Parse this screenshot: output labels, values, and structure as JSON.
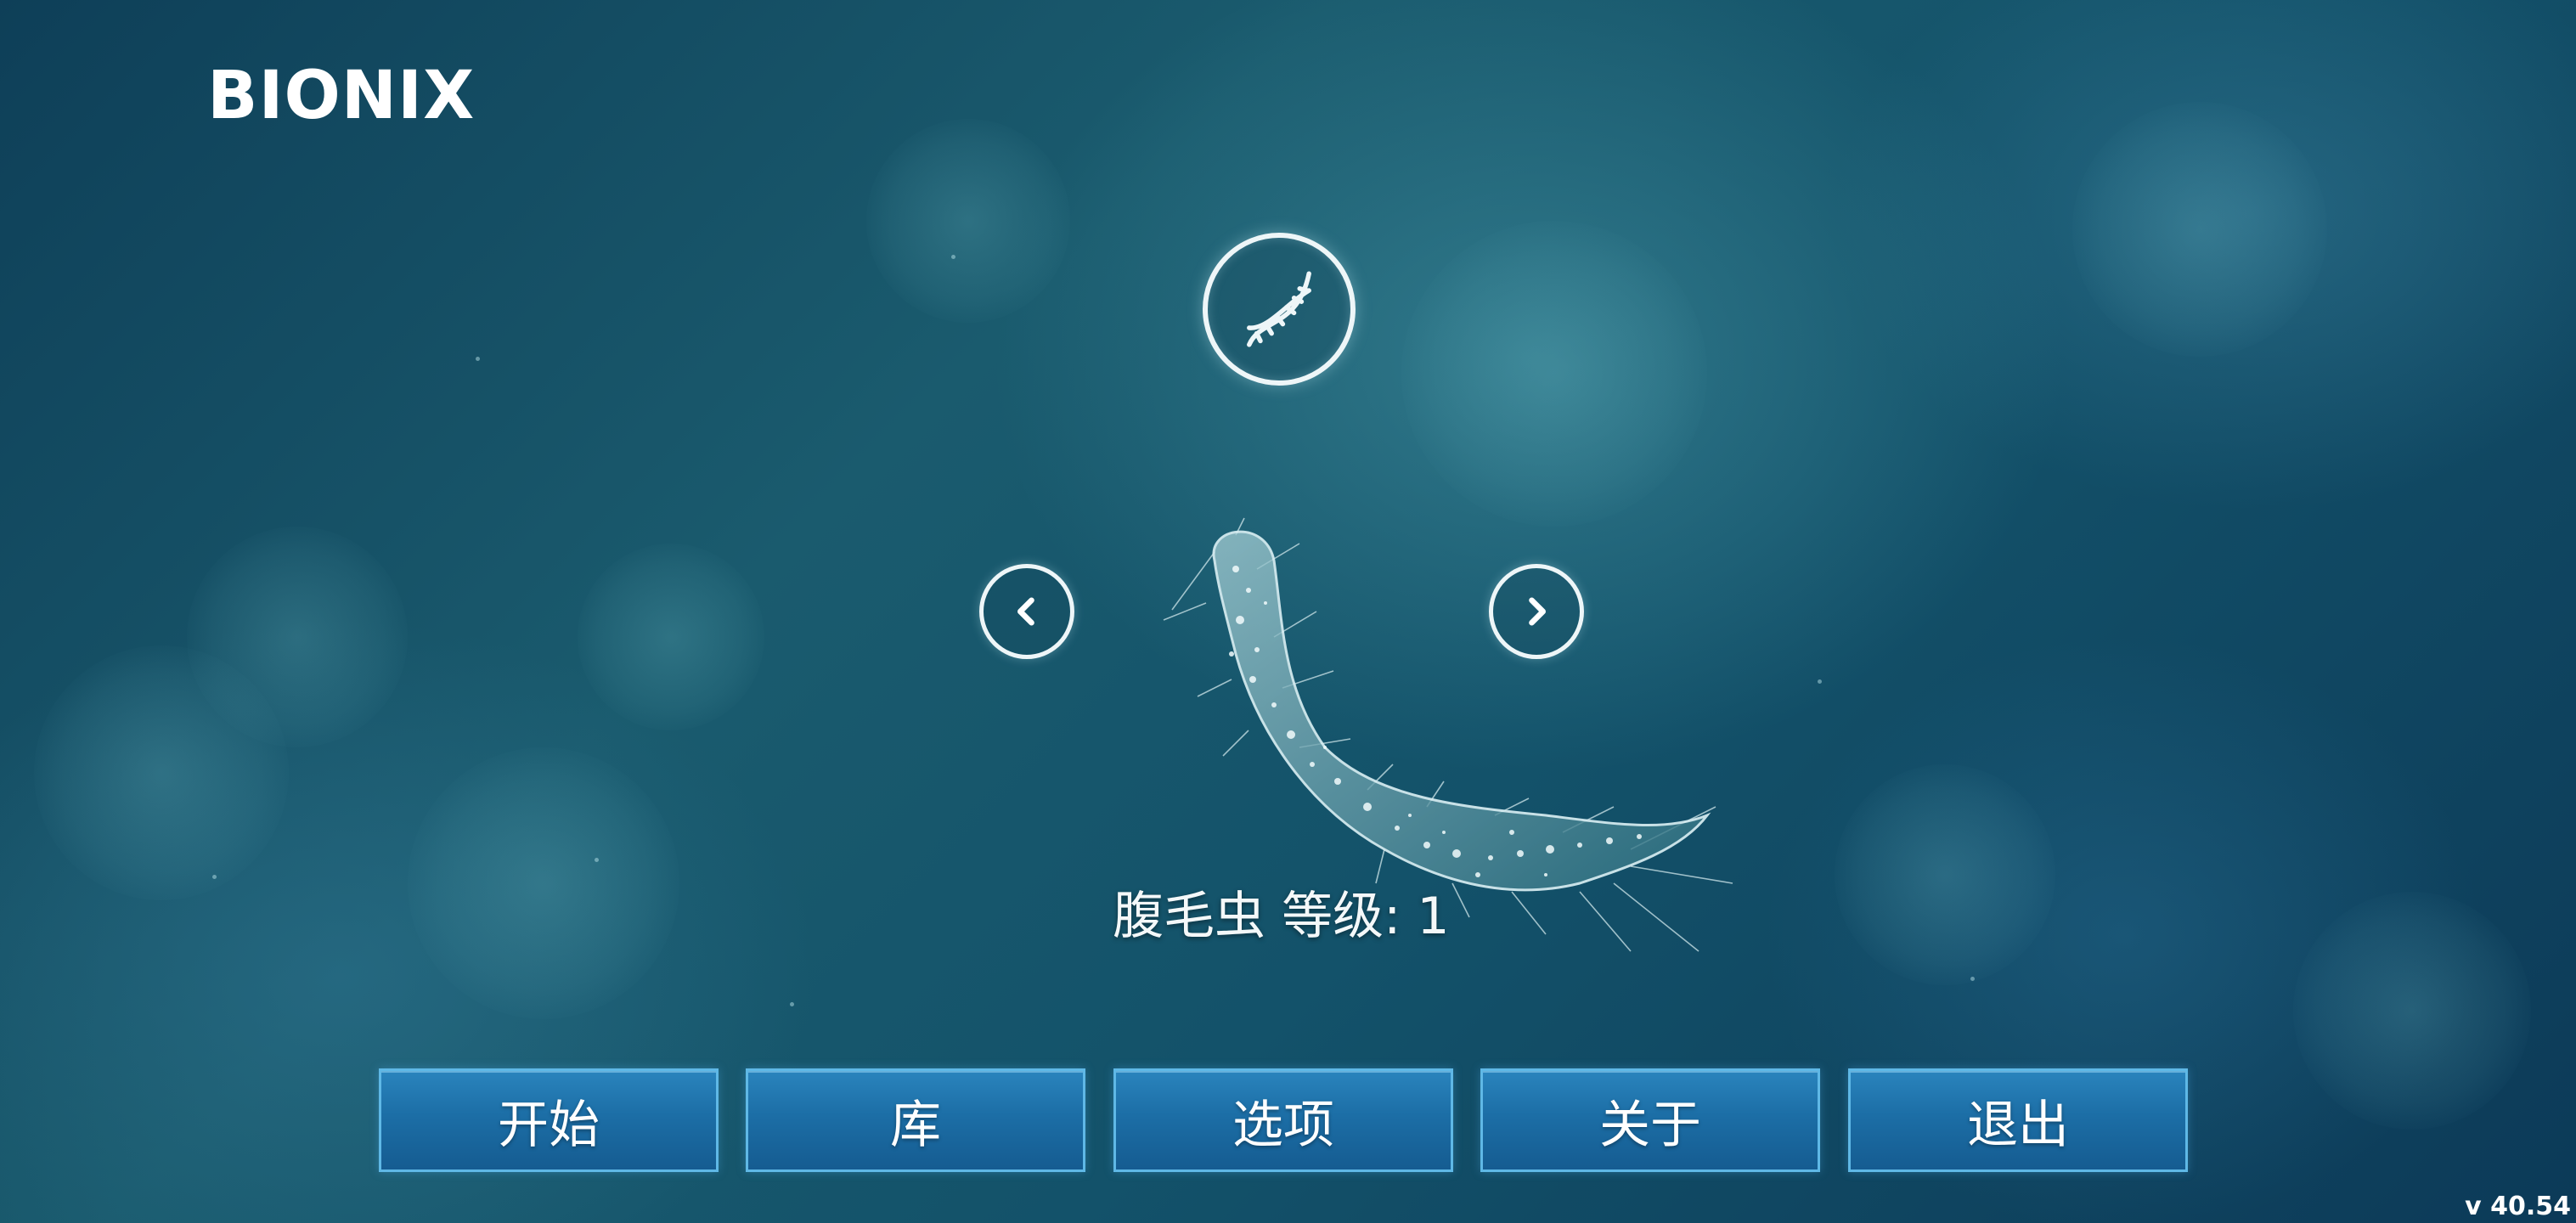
{
  "app": {
    "logo_text": "BIONIX",
    "version": "v 40.54"
  },
  "icons": {
    "dna": "dna-icon",
    "prev": "chevron-left-icon",
    "next": "chevron-right-icon"
  },
  "species": {
    "name": "腹毛虫",
    "level_text": "等级: 1"
  },
  "menu": {
    "start": "开始",
    "library": "库",
    "options": "选项",
    "about": "关于",
    "exit": "退出"
  },
  "colors": {
    "background": "#13526a",
    "button_fill": "#1c6ea6",
    "button_border": "#5fb8e6",
    "text": "#ffffff"
  }
}
